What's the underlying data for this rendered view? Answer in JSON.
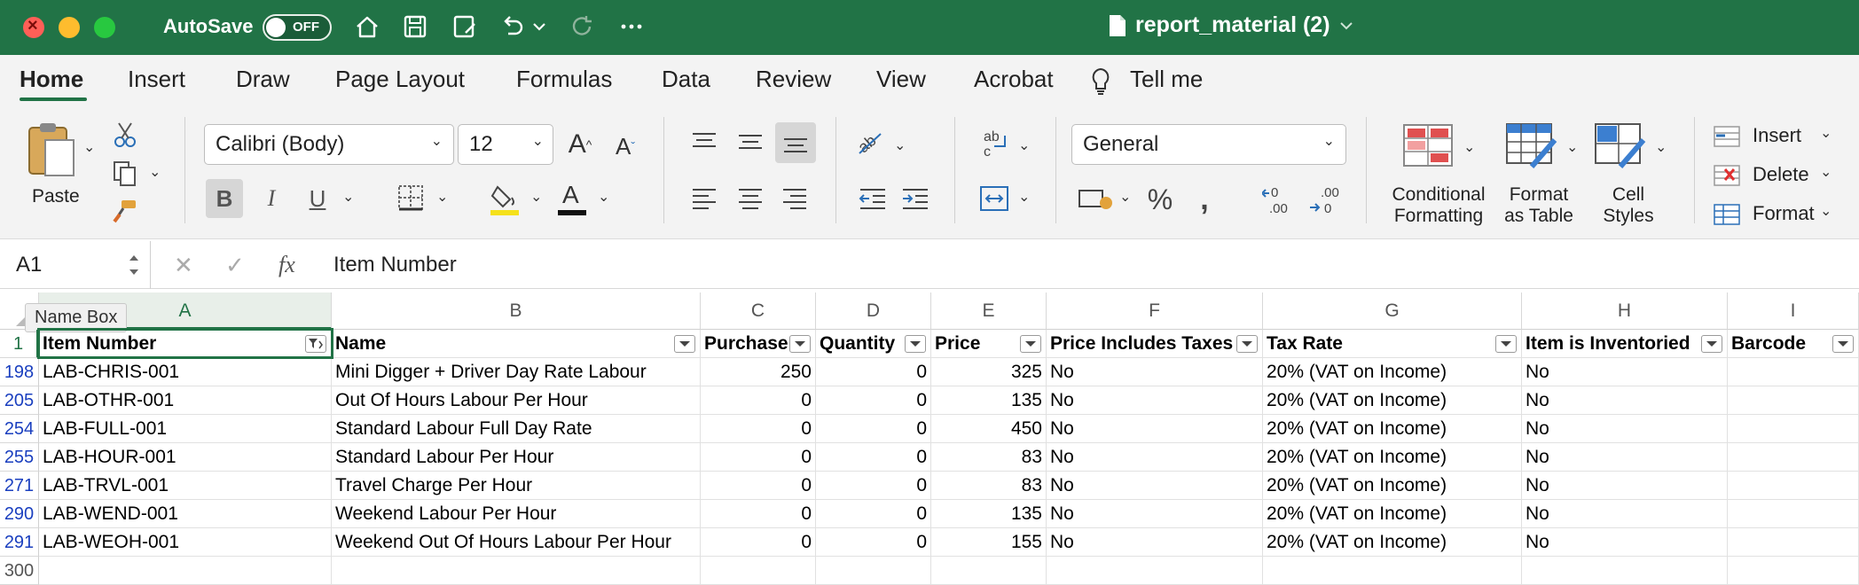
{
  "titlebar": {
    "autosave_label": "AutoSave",
    "autosave_state": "OFF",
    "doc_title": "report_material (2)",
    "bg_color": "#217346"
  },
  "tabs": [
    "Home",
    "Insert",
    "Draw",
    "Page Layout",
    "Formulas",
    "Data",
    "Review",
    "View",
    "Acrobat",
    "Tell me"
  ],
  "ribbon": {
    "paste_label": "Paste",
    "font_name": "Calibri (Body)",
    "font_size": "12",
    "number_format": "General",
    "conditional_formatting": [
      "Conditional",
      "Formatting"
    ],
    "format_as_table": [
      "Format",
      "as Table"
    ],
    "cell_styles": [
      "Cell",
      "Styles"
    ],
    "insert_label": "Insert",
    "delete_label": "Delete",
    "format_label": "Format"
  },
  "formula_bar": {
    "name_box": "A1",
    "formula": "Item Number",
    "tooltip": "Name Box"
  },
  "columns": [
    "A",
    "B",
    "C",
    "D",
    "E",
    "F",
    "G",
    "H",
    "I"
  ],
  "header_row": {
    "row_number": "1",
    "cells": [
      "Item Number",
      "Name",
      "Purchase",
      "Quantity",
      "Price",
      "Price Includes Taxes",
      "Tax Rate",
      "Item is Inventoried",
      "Barcode"
    ]
  },
  "rows": [
    {
      "row_number": "198",
      "cells": [
        "LAB-CHRIS-001",
        "Mini Digger + Driver Day Rate Labour",
        "250",
        "0",
        "325",
        "No",
        "20% (VAT on Income)",
        "No",
        ""
      ]
    },
    {
      "row_number": "205",
      "cells": [
        "LAB-OTHR-001",
        "Out Of Hours Labour Per Hour",
        "0",
        "0",
        "135",
        "No",
        "20% (VAT on Income)",
        "No",
        ""
      ]
    },
    {
      "row_number": "254",
      "cells": [
        "LAB-FULL-001",
        "Standard Labour Full Day Rate",
        "0",
        "0",
        "450",
        "No",
        "20% (VAT on Income)",
        "No",
        ""
      ]
    },
    {
      "row_number": "255",
      "cells": [
        "LAB-HOUR-001",
        "Standard Labour Per Hour",
        "0",
        "0",
        "83",
        "No",
        "20% (VAT on Income)",
        "No",
        ""
      ]
    },
    {
      "row_number": "271",
      "cells": [
        "LAB-TRVL-001",
        "Travel Charge Per Hour",
        "0",
        "0",
        "83",
        "No",
        "20% (VAT on Income)",
        "No",
        ""
      ]
    },
    {
      "row_number": "290",
      "cells": [
        "LAB-WEND-001",
        "Weekend Labour Per Hour",
        "0",
        "0",
        "135",
        "No",
        "20% (VAT on Income)",
        "No",
        ""
      ]
    },
    {
      "row_number": "291",
      "cells": [
        "LAB-WEOH-001",
        "Weekend Out Of Hours Labour Per Hour",
        "0",
        "0",
        "155",
        "No",
        "20% (VAT on Income)",
        "No",
        ""
      ]
    }
  ],
  "last_row": {
    "row_number": "300"
  }
}
